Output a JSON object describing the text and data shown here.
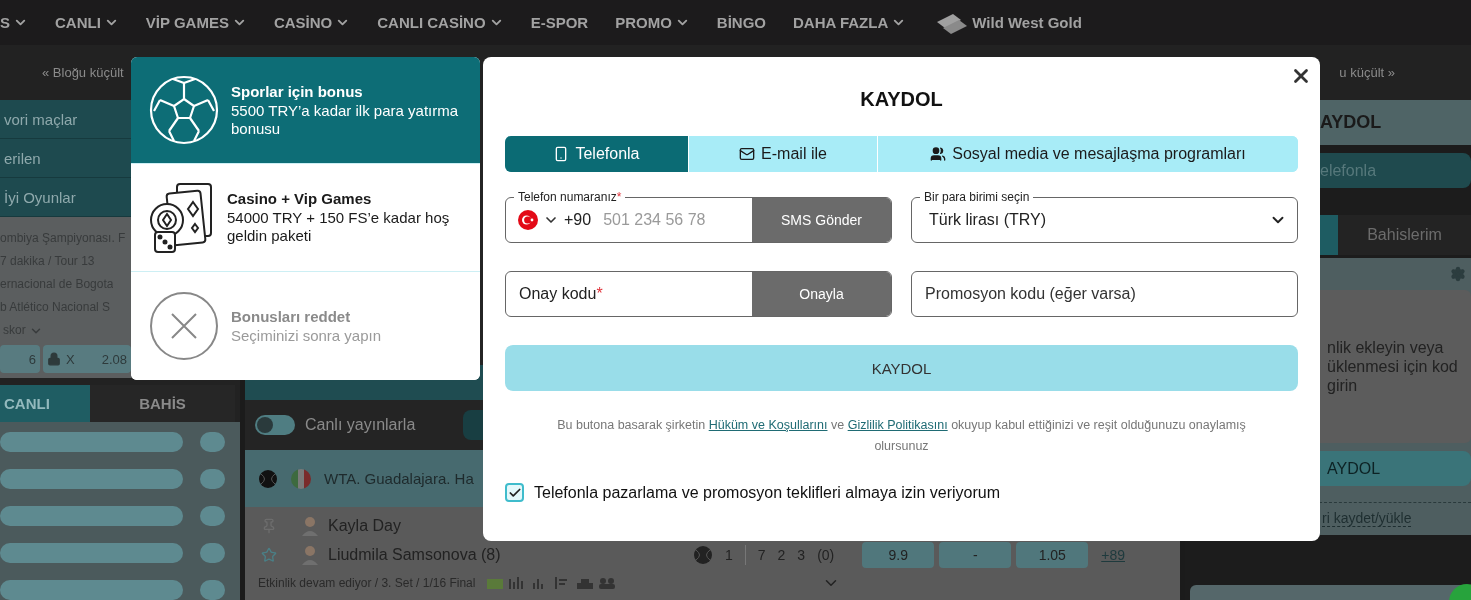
{
  "top_nav": [
    {
      "label": "S",
      "dropdown": true
    },
    {
      "label": "CANLI",
      "dropdown": true
    },
    {
      "label": "VİP GAMES",
      "dropdown": true
    },
    {
      "label": "CASİNO",
      "dropdown": true
    },
    {
      "label": "CANLI CASİNO",
      "dropdown": true
    },
    {
      "label": "E-SPOR",
      "dropdown": false
    },
    {
      "label": "PROMO",
      "dropdown": true
    },
    {
      "label": "BİNGO",
      "dropdown": false
    },
    {
      "label": "DAHA FAZLA",
      "dropdown": true
    },
    {
      "label": "Wild West Gold",
      "dropdown": false,
      "kind": "game"
    }
  ],
  "sub_bar": {
    "left": "« Bloğu küçült",
    "right": "u küçült »"
  },
  "left_sidebar": {
    "menu": [
      "vori maçlar",
      "erilen",
      "İyi Oyunlar"
    ],
    "match": {
      "league": "ombiya Şampiyonası. F",
      "time": "7 dakika / Tour 13",
      "team_1": "ernacional de Bogota",
      "team_2": "b Atlético Nacional S",
      "score_toggle": "skor",
      "odds": [
        {
          "value": "6",
          "locked": false
        },
        {
          "label": "X",
          "value": "2.08",
          "locked": true
        }
      ]
    },
    "tabs": [
      {
        "label": "CANLI",
        "selected": true
      },
      {
        "label": "BAHİS",
        "selected": false
      }
    ]
  },
  "center": {
    "stream_toggle": {
      "label": "Canlı yayınlarla",
      "on": false
    },
    "event": {
      "league": "WTA. Guadalajara. Ha",
      "players": [
        {
          "name": "Kayla Day"
        },
        {
          "name": "Liudmila Samsonova (8)",
          "serving": true,
          "scores": [
            "1",
            "7",
            "2",
            "3",
            "(0)"
          ]
        }
      ],
      "odds": [
        "9.9",
        "-",
        "1.05"
      ],
      "more": "+89",
      "status": "Etkinlik devam ediyor / 3. Set / 1/16 Final"
    }
  },
  "right_panel": {
    "title": "AYDOL",
    "phone_button": "elefonla",
    "my_bets_tab": {
      "label": "Bahislerim",
      "selected": false
    },
    "message": [
      "nlik ekleyin veya",
      "üklenmesi için kod",
      "girin"
    ],
    "register_button": "AYDOL",
    "save_link": "ri kaydet/yükle"
  },
  "bonus_panel": [
    {
      "kind": "sports",
      "title": "Sporlar için bonus",
      "text": "5500 TRY’a kadar ilk para yatırma bonusu",
      "selected": true
    },
    {
      "kind": "casino",
      "title": "Casino + Vip Games",
      "text": "54000 TRY + 150 FS’e kadar hoş geldin paketi",
      "selected": false
    },
    {
      "kind": "decline",
      "title": "Bonusları reddet",
      "text": "Seçiminizi sonra yapın",
      "selected": false
    }
  ],
  "modal": {
    "title": "KAYDOL",
    "tabs": [
      {
        "kind": "phone",
        "label": "Telefonla",
        "selected": true
      },
      {
        "kind": "email",
        "label": "E-mail ile",
        "selected": false
      },
      {
        "kind": "social",
        "label": "Sosyal media ve mesajlaşma programları",
        "selected": false
      }
    ],
    "phone": {
      "label": "Telefon numaranız",
      "required_mark": "*",
      "country_code": "+90",
      "placeholder": "501 234 56 78",
      "button": "SMS Gönder"
    },
    "currency": {
      "label": "Bir para birimi seçin",
      "value": "Türk lirası (TRY)"
    },
    "code": {
      "label": "Onay kodu",
      "required_mark": "*",
      "button": "Onayla"
    },
    "promo": {
      "placeholder": "Promosyon kodu (eğer varsa)"
    },
    "submit": "KAYDOL",
    "terms": [
      {
        "kind": "text",
        "text": "Bu butona basarak şirketin "
      },
      {
        "kind": "link",
        "text": "Hüküm ve Koşullarını"
      },
      {
        "kind": "text",
        "text": " ve "
      },
      {
        "kind": "link",
        "text": "Gizlilik Politikasını"
      },
      {
        "kind": "text",
        "text": " okuyup kabul ettiğinizi ve reşit olduğunuzu onaylamış olursunuz"
      }
    ],
    "consent": {
      "label": "Telefonla pazarlama ve promosyon teklifleri almaya izin veriyorum",
      "checked": true
    }
  }
}
